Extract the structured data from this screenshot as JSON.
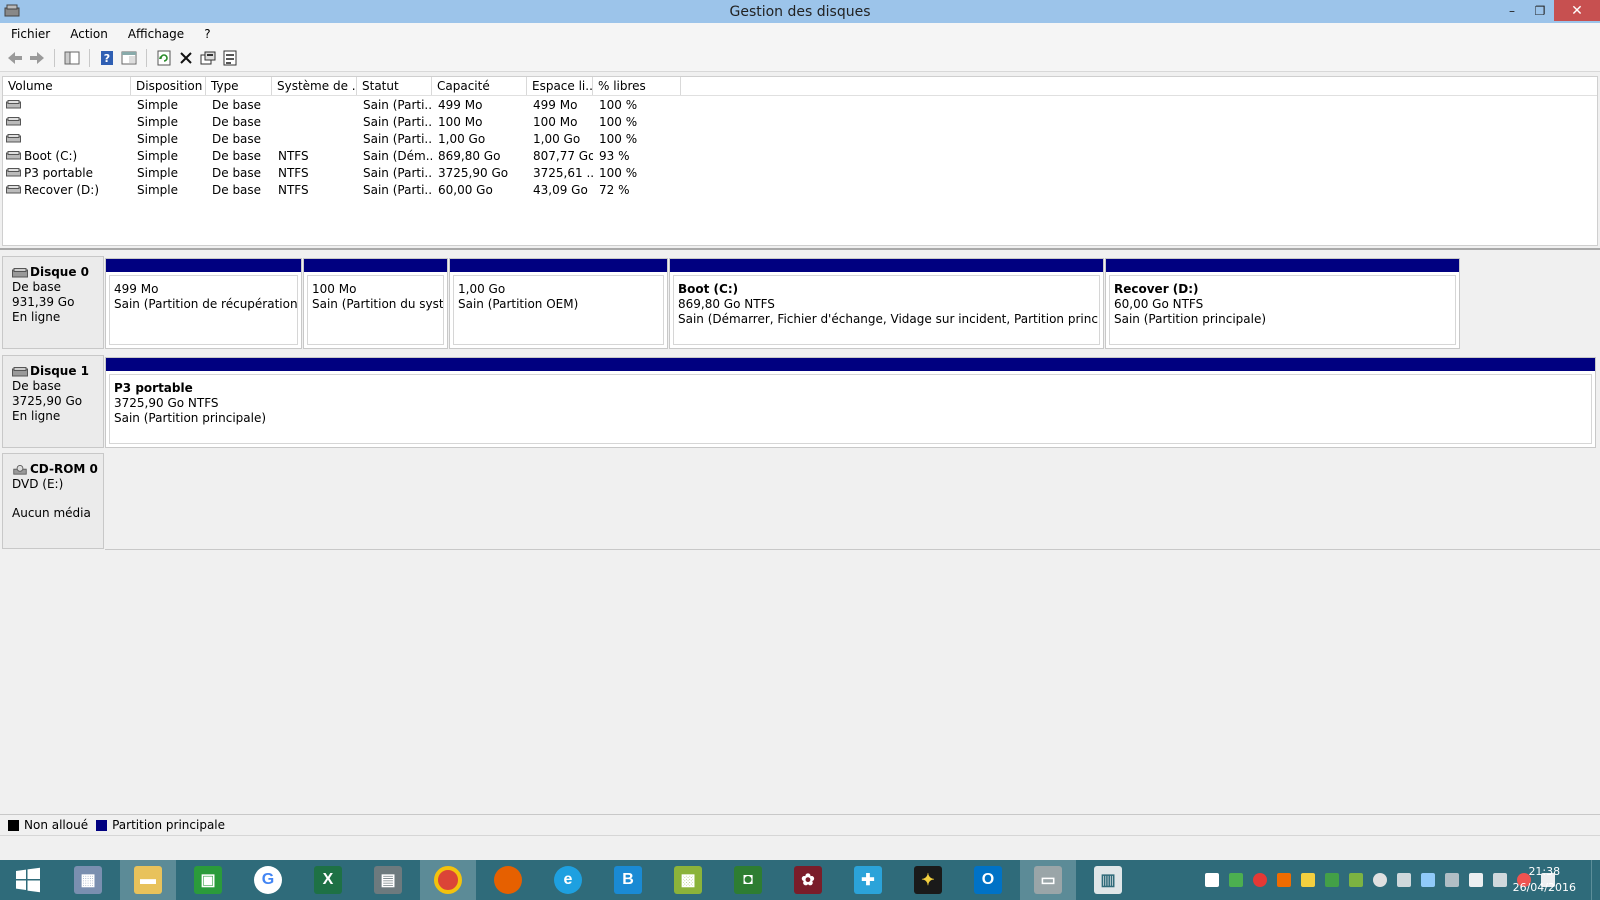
{
  "window": {
    "title": "Gestion des disques",
    "controls": {
      "minimize": "–",
      "restore": "❐",
      "close": "✕"
    }
  },
  "menu": [
    "Fichier",
    "Action",
    "Affichage",
    "?"
  ],
  "toolbar": {
    "buttons": [
      "back-icon",
      "forward-icon",
      "console-tree-icon",
      "help-icon",
      "view-icon",
      "refresh-icon",
      "delete-icon",
      "properties-icon",
      "export-list-icon"
    ]
  },
  "volume_list": {
    "columns": [
      "Volume",
      "Disposition",
      "Type",
      "Système de ...",
      "Statut",
      "Capacité",
      "Espace li...",
      "% libres"
    ],
    "rows": [
      {
        "volume": "",
        "disposition": "Simple",
        "type": "De base",
        "fs": "",
        "statut": "Sain (Parti...",
        "capacite": "499 Mo",
        "espace": "499 Mo",
        "libres": "100 %"
      },
      {
        "volume": "",
        "disposition": "Simple",
        "type": "De base",
        "fs": "",
        "statut": "Sain (Parti...",
        "capacite": "100 Mo",
        "espace": "100 Mo",
        "libres": "100 %"
      },
      {
        "volume": "",
        "disposition": "Simple",
        "type": "De base",
        "fs": "",
        "statut": "Sain (Parti...",
        "capacite": "1,00 Go",
        "espace": "1,00 Go",
        "libres": "100 %"
      },
      {
        "volume": "Boot (C:)",
        "disposition": "Simple",
        "type": "De base",
        "fs": "NTFS",
        "statut": "Sain (Dém...",
        "capacite": "869,80 Go",
        "espace": "807,77 Go",
        "libres": "93 %"
      },
      {
        "volume": "P3 portable",
        "disposition": "Simple",
        "type": "De base",
        "fs": "NTFS",
        "statut": "Sain (Parti...",
        "capacite": "3725,90 Go",
        "espace": "3725,61 ...",
        "libres": "100 %"
      },
      {
        "volume": "Recover (D:)",
        "disposition": "Simple",
        "type": "De base",
        "fs": "NTFS",
        "statut": "Sain (Parti...",
        "capacite": "60,00 Go",
        "espace": "43,09 Go",
        "libres": "72 %"
      }
    ]
  },
  "disks": [
    {
      "name": "Disque 0",
      "kind": "De base",
      "size": "931,39 Go",
      "state": "En ligne",
      "partitions": [
        {
          "name": "",
          "size": "499 Mo",
          "status": "Sain (Partition de récupération)"
        },
        {
          "name": "",
          "size": "100 Mo",
          "status": "Sain (Partition du systèm"
        },
        {
          "name": "",
          "size": "1,00 Go",
          "status": "Sain (Partition OEM)"
        },
        {
          "name": "Boot  (C:)",
          "size": "869,80 Go NTFS",
          "status": "Sain (Démarrer, Fichier d'échange, Vidage sur incident, Partition principale)"
        },
        {
          "name": "Recover  (D:)",
          "size": "60,00 Go NTFS",
          "status": "Sain (Partition principale)"
        }
      ]
    },
    {
      "name": "Disque 1",
      "kind": "De base",
      "size": "3725,90 Go",
      "state": "En ligne",
      "partitions": [
        {
          "name": "P3 portable",
          "size": "3725,90 Go NTFS",
          "status": "Sain (Partition principale)"
        }
      ]
    },
    {
      "name": "CD-ROM 0",
      "drive": "DVD (E:)",
      "state": "Aucun média"
    }
  ],
  "legend": [
    {
      "label": "Non alloué",
      "color": "#000000"
    },
    {
      "label": "Partition principale",
      "color": "#000080"
    }
  ],
  "taskbar": {
    "apps": [
      "windows-start-icon",
      "calculator-icon",
      "file-explorer-icon",
      "store-icon",
      "google-icon",
      "excel-icon",
      "app-grid-icon",
      "chrome-icon",
      "firefox-icon",
      "internet-explorer-icon",
      "b-app-icon",
      "game-app-icon",
      "red-app-icon",
      "puzzle-app-icon",
      "star-app-icon",
      "outlook-icon",
      "disk-management-icon",
      "slides-app-icon"
    ],
    "clock_time": "21:38",
    "clock_date": "26/04/2016"
  },
  "colors": {
    "partition_bar": "#000080",
    "titlebar": "#9cc4ea",
    "taskbar": "#2f6b7a",
    "close": "#c75050"
  }
}
